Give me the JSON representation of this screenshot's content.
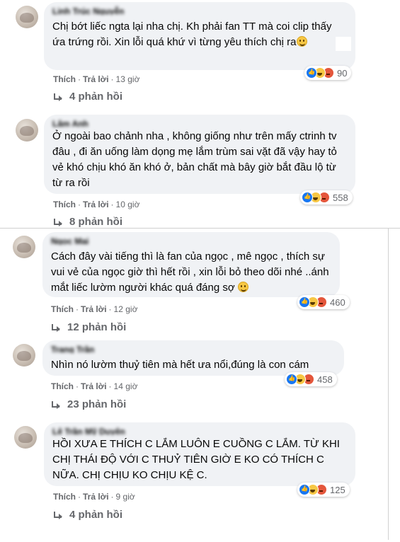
{
  "comments": [
    {
      "name": "Linh Trúc Nguyễn",
      "text": "Chị bớt liếc ngta lại nha chị. Kh phải fan TT mà coi clip thấy ứa trứng rồi. Xin lỗi quá khứ vì từng yêu thích chị ra",
      "emoji": "smile-emoji",
      "reactions": [
        "like",
        "haha",
        "angry"
      ],
      "reaction_count": "90",
      "like_label": "Thích",
      "reply_label": "Trả lời",
      "time": "13 giờ",
      "replies_label": "4 phản hồi"
    },
    {
      "name": "Lâm Anh",
      "text": "Ở ngoài bao chảnh nha , không giống như trên mấy ctrinh tv đâu , đi ăn uống làm dọng mẹ lắm trùm sai vặt đã vậy hay tỏ vẻ khó chịu khó ăn khó ở, bản chất mà bây giờ bắt đầu lộ từ từ ra rồi",
      "emoji": "",
      "reactions": [
        "like",
        "haha",
        "angry"
      ],
      "reaction_count": "558",
      "like_label": "Thích",
      "reply_label": "Trả lời",
      "time": "10 giờ",
      "replies_label": "8 phản hồi"
    },
    {
      "name": "Ngọc Mai",
      "text": "Cách đây vài tiếng thì là fan của ngọc , mê ngọc , thích sự vui vẻ của ngọc giờ thì hết rồi , xin lỗi bỏ theo dõi nhé ..ánh mắt liếc lườm người khác quá đáng sợ",
      "emoji": "smile-emoji",
      "reactions": [
        "like",
        "haha",
        "angry"
      ],
      "reaction_count": "460",
      "like_label": "Thích",
      "reply_label": "Trả lời",
      "time": "12 giờ",
      "replies_label": "12 phản hồi"
    },
    {
      "name": "Trang Trần",
      "text": "Nhìn nó lườm thuỷ tiên mà hết ưa nổi,đúng là con cám",
      "emoji": "",
      "reactions": [
        "like",
        "haha",
        "angry"
      ],
      "reaction_count": "458",
      "like_label": "Thích",
      "reply_label": "Trả lời",
      "time": "14 giờ",
      "replies_label": "23 phản hồi"
    },
    {
      "name": "Lê Trần Mỹ Duyên",
      "text": "HỒI XƯA E THÍCH C LẮM LUÔN E CUỒNG C LẮM. TỪ KHI CHỊ THÁI ĐỘ VỚI C THUỶ TIÊN GIỜ E KO CÓ THÍCH C NỮA. CHỊ CHỊU KO CHỊU KỆ C.",
      "emoji": "",
      "reactions": [
        "like",
        "haha",
        "angry"
      ],
      "reaction_count": "125",
      "like_label": "Thích",
      "reply_label": "Trả lời",
      "time": "9 giờ",
      "replies_label": "4 phản hồi"
    }
  ],
  "colors": {
    "bubble": "#f0f2f5",
    "meta_text": "#65676b",
    "like_blue": "#1877f2",
    "haha_yellow": "#f7c744",
    "angry_red": "#e4563b"
  }
}
